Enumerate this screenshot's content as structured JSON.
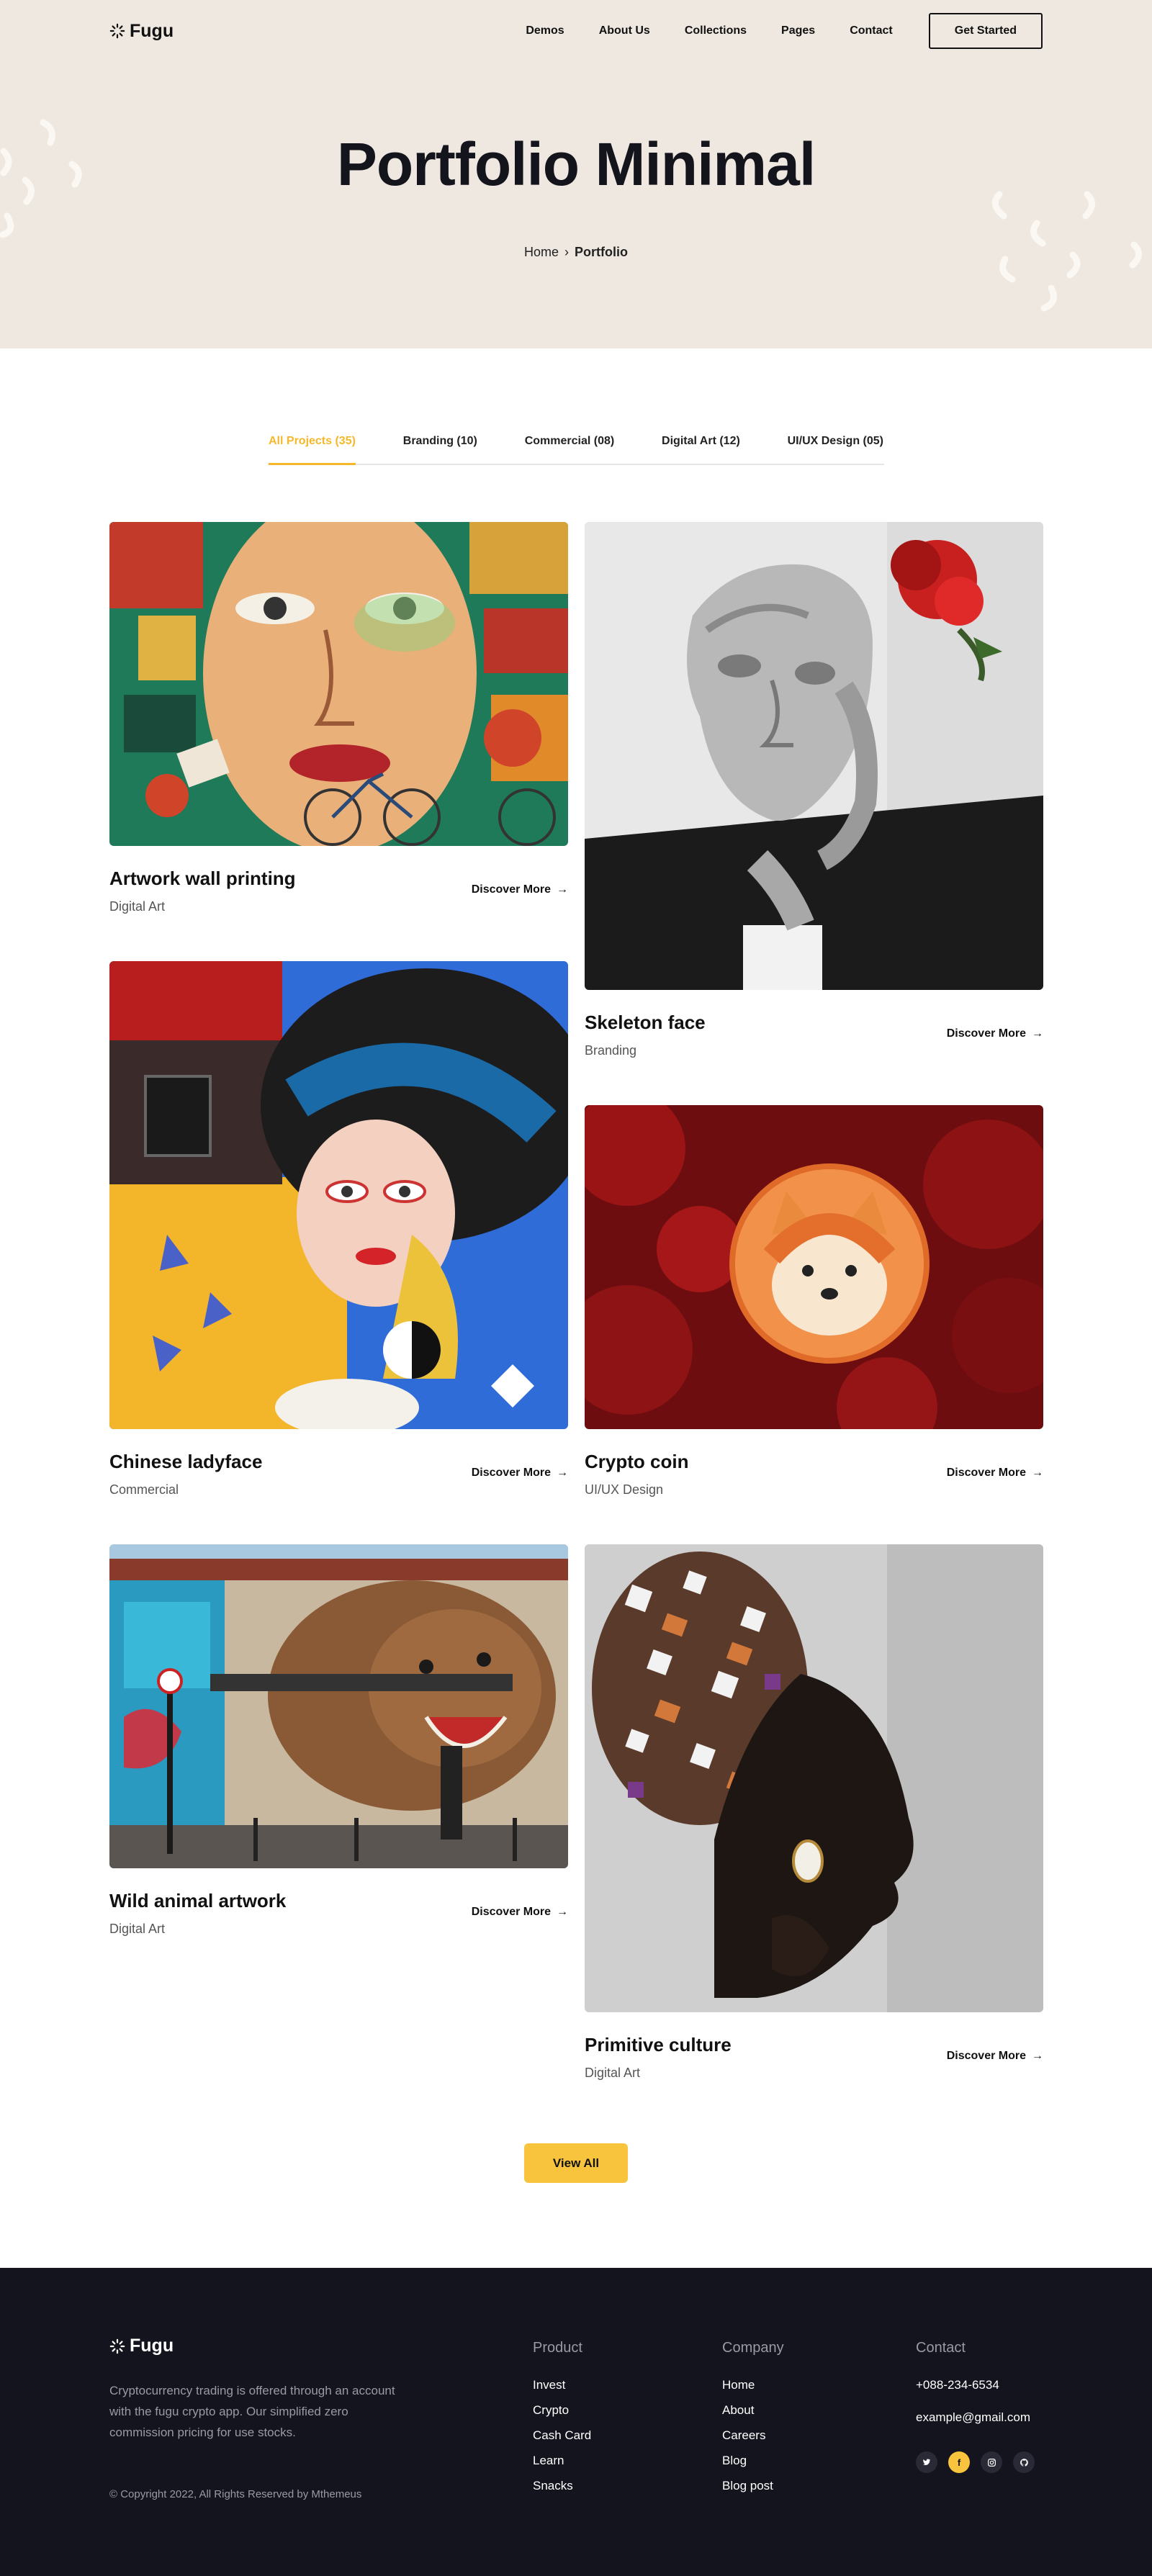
{
  "brand": {
    "name": "Fugu"
  },
  "nav": {
    "links": [
      "Demos",
      "About Us",
      "Collections",
      "Pages",
      "Contact"
    ],
    "cta": "Get Started"
  },
  "hero": {
    "title": "Portfolio Minimal",
    "breadcrumb": {
      "home": "Home",
      "separator": "›",
      "current": "Portfolio"
    }
  },
  "filters": [
    "All Projects (35)",
    "Branding (10)",
    "Commercial (08)",
    "Digital Art (12)",
    "UI/UX Design (05)"
  ],
  "projects": [
    {
      "title": "Artwork wall printing",
      "category": "Digital Art",
      "link": "Discover More",
      "image": "colorful face mural with bicycles"
    },
    {
      "title": "Skeleton face",
      "category": "Branding",
      "link": "Discover More",
      "image": "stone face sculpture with red rose"
    },
    {
      "title": "Chinese ladyface",
      "category": "Commercial",
      "link": "Discover More",
      "image": "illustrated woman mural"
    },
    {
      "title": "Crypto coin",
      "category": "UI/UX Design",
      "link": "Discover More",
      "image": "shiba coin on red roses"
    },
    {
      "title": "Wild animal artwork",
      "category": "Digital Art",
      "link": "Discover More",
      "image": "bear graffiti wall"
    },
    {
      "title": "Primitive culture",
      "category": "Digital Art",
      "link": "Discover More",
      "image": "woman with patterned headwrap"
    }
  ],
  "view_all": "View All",
  "footer": {
    "description": "Cryptocurrency trading is offered through an account with the fugu crypto app. Our simplified zero commission pricing for use stocks.",
    "copyright": "© Copyright 2022, All Rights Reserved by Mthemeus",
    "product": {
      "heading": "Product",
      "items": [
        "Invest",
        "Crypto",
        "Cash Card",
        "Learn",
        "Snacks"
      ]
    },
    "company": {
      "heading": "Company",
      "items": [
        "Home",
        "About",
        "Careers",
        "Blog",
        "Blog post"
      ]
    },
    "contact": {
      "heading": "Contact",
      "phone": "+088-234-6534",
      "email": "example@gmail.com"
    },
    "socials": [
      "twitter-icon",
      "facebook-icon",
      "instagram-icon",
      "github-icon"
    ]
  },
  "colors": {
    "accent": "#f8c33d",
    "hero_bg": "#efe8e0",
    "footer_bg": "#14141e"
  }
}
